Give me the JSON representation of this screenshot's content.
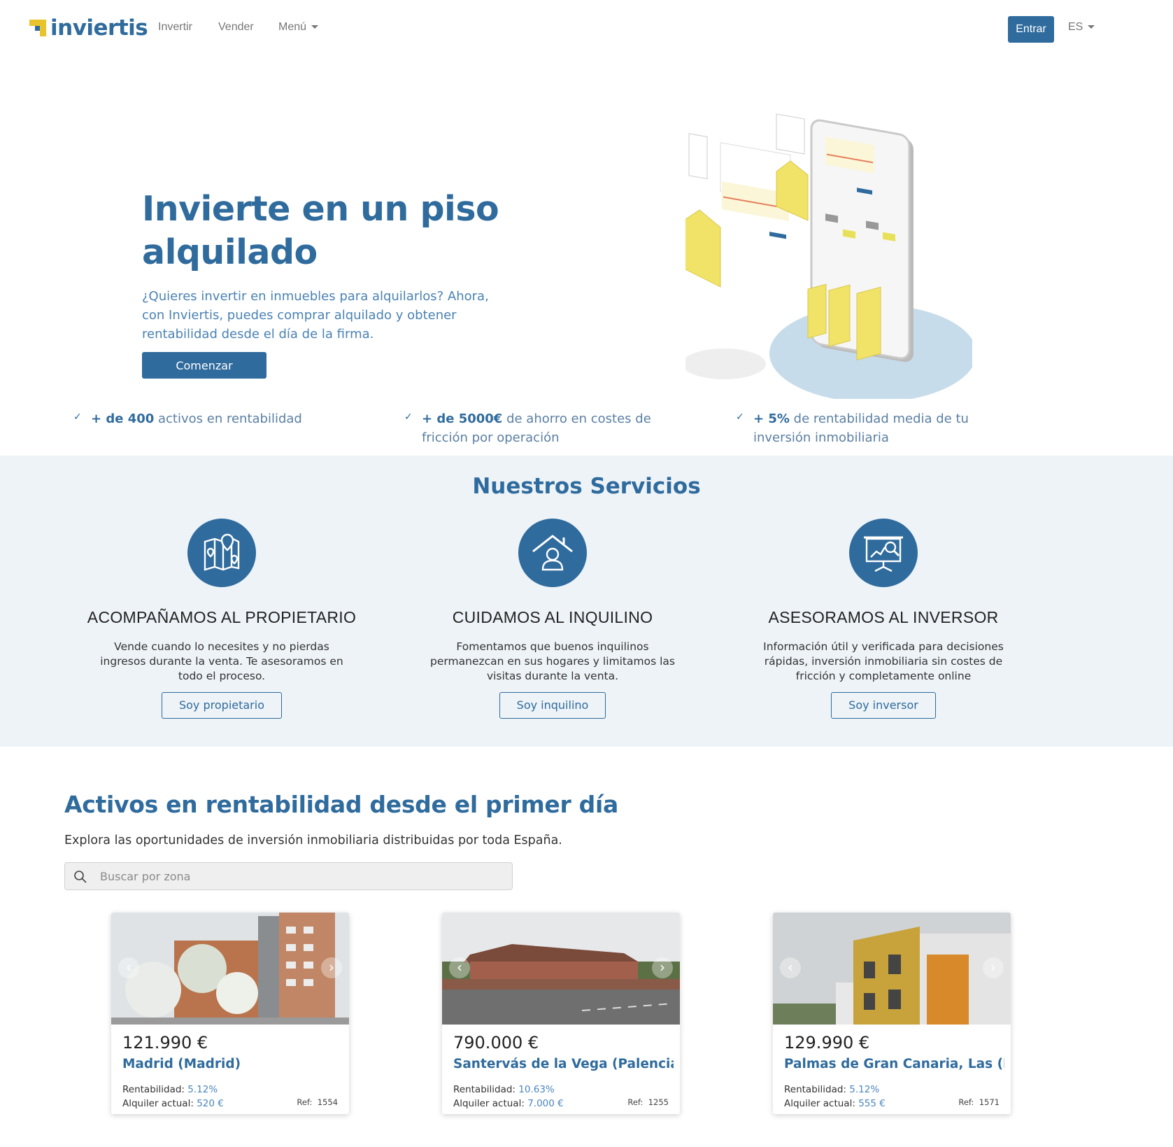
{
  "nav": {
    "brand": "inviertis",
    "links": [
      "Invertir",
      "Vender"
    ],
    "menu_label": "Menú",
    "login_label": "Entrar",
    "language": "ES"
  },
  "hero": {
    "title": "Invierte en un piso alquilado",
    "text": "¿Quieres invertir en inmuebles para alquilarlos? Ahora, con Inviertis, puedes comprar alquilado y obtener rentabilidad desde el día de la firma.",
    "cta_label": "Comenzar"
  },
  "features": [
    {
      "bold": "+ de 400",
      "text": " activos en rentabilidad"
    },
    {
      "bold": "+ de 5000€",
      "text": " de ahorro en costes de fricción por operación"
    },
    {
      "bold": "+ 5%",
      "text": " de rentabilidad media de tu inversión inmobiliaria"
    }
  ],
  "services": {
    "title": "Nuestros Servicios",
    "items": [
      {
        "icon": "map-pins-icon",
        "title": "ACOMPAÑAMOS AL PROPIETARIO",
        "text": "Vende cuando lo necesites y no pierdas ingresos durante la venta. Te asesoramos en todo el proceso.",
        "button": "Soy propietario"
      },
      {
        "icon": "house-person-icon",
        "title": "CUIDAMOS AL INQUILINO",
        "text": "Fomentamos que buenos inquilinos permanezcan en sus hogares y limitamos las visitas durante la venta.",
        "button": "Soy inquilino"
      },
      {
        "icon": "presentation-magnifier-icon",
        "title": "ASESORAMOS AL INVERSOR",
        "text": "Información útil y verificada para decisiones rápidas, inversión inmobiliaria sin costes de fricción y completamente online",
        "button": "Soy inversor"
      }
    ]
  },
  "listings": {
    "title": "Activos en rentabilidad desde el primer día",
    "subtitle": "Explora las oportunidades de inversión inmobiliaria distribuidas por toda España.",
    "search_placeholder": "Buscar por zona",
    "rent_label": "Rentabilidad:",
    "current_rent_label": "Alquiler actual:",
    "ref_label": "Ref:",
    "cards": [
      {
        "price": "121.990 €",
        "city": "Madrid (Madrid)",
        "rentability": "5.12%",
        "rent": "520 €",
        "ref": "1554"
      },
      {
        "price": "790.000 €",
        "city": "Santervás de la Vega (Palencia)",
        "rentability": "10.63%",
        "rent": "7.000 €",
        "ref": "1255"
      },
      {
        "price": "129.990 €",
        "city": "Palmas de Gran Canaria, Las (L...",
        "rentability": "5.12%",
        "rent": "555 €",
        "ref": "1571"
      }
    ]
  },
  "colors": {
    "primary": "#2f6b9d",
    "accent_yellow": "#e9c32c",
    "services_bg": "#edf3f7"
  }
}
